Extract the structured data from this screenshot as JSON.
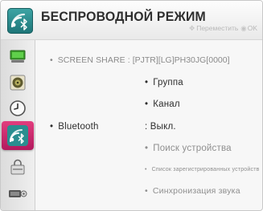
{
  "header": {
    "title": "БЕСПРОВОДНОЙ РЕЖИМ",
    "hint_move": "Переместить",
    "hint_ok": "OK"
  },
  "sidebar": {
    "items": [
      {
        "icon": "display-icon",
        "active": false
      },
      {
        "icon": "speaker-icon",
        "active": false
      },
      {
        "icon": "clock-icon",
        "active": false
      },
      {
        "icon": "wireless-icon",
        "active": true
      },
      {
        "icon": "lock-icon",
        "active": false
      },
      {
        "icon": "support-icon",
        "active": false
      }
    ]
  },
  "main": {
    "screen_share": {
      "label": "SCREEN SHARE :",
      "value": "[PJTR][LG]PH30JG[0000]"
    },
    "options": {
      "group": "Группа",
      "channel": "Канал"
    },
    "bluetooth": {
      "label": "Bluetooth",
      "value": ": Выкл."
    },
    "bluetooth_options": {
      "search": "Поиск устройства",
      "registered": "Список зарегистрированных устройств",
      "sync": "Синхронизация звука"
    }
  },
  "colors": {
    "accent_active": "#c8246a",
    "header_logo": "#2b8c8e",
    "text_dark": "#2e2e2e",
    "text_dim": "#8f8f8f"
  }
}
